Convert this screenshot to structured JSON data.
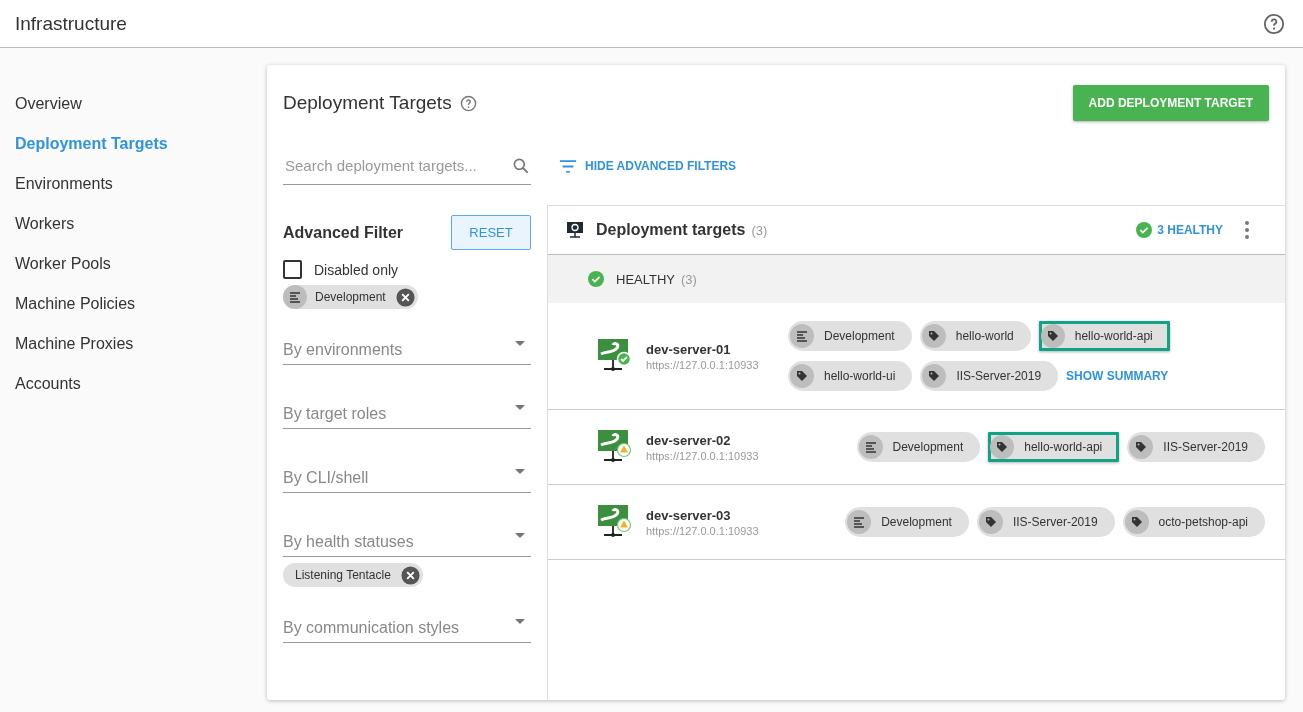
{
  "header": {
    "title": "Infrastructure"
  },
  "sidebar": {
    "items": [
      {
        "label": "Overview",
        "selected": false
      },
      {
        "label": "Deployment Targets",
        "selected": true
      },
      {
        "label": "Environments",
        "selected": false
      },
      {
        "label": "Workers",
        "selected": false
      },
      {
        "label": "Worker Pools",
        "selected": false
      },
      {
        "label": "Machine Policies",
        "selected": false
      },
      {
        "label": "Machine Proxies",
        "selected": false
      },
      {
        "label": "Accounts",
        "selected": false
      }
    ]
  },
  "page": {
    "title": "Deployment Targets",
    "add_button": "ADD DEPLOYMENT TARGET"
  },
  "search": {
    "placeholder": "Search deployment targets..."
  },
  "filters_toggle": "HIDE ADVANCED FILTERS",
  "advanced_filter": {
    "title": "Advanced Filter",
    "reset": "RESET",
    "disabled_only": {
      "label": "Disabled only",
      "checked": false
    },
    "fields": [
      {
        "kind": "environment_chip",
        "label": "Development"
      },
      {
        "kind": "select",
        "placeholder": "By environments"
      },
      {
        "kind": "select",
        "placeholder": "By target roles"
      },
      {
        "kind": "select",
        "placeholder": "By CLI/shell"
      },
      {
        "kind": "select",
        "placeholder": "By health statuses"
      },
      {
        "kind": "chip",
        "label": "Listening Tentacle"
      },
      {
        "kind": "select",
        "placeholder": "By communication styles"
      }
    ]
  },
  "targets_panel": {
    "title": "Deployment targets",
    "count": "(3)",
    "summary": "3 HEALTHY",
    "group": {
      "label": "HEALTHY",
      "count": "(3)"
    },
    "rows": [
      {
        "name": "dev-server-01",
        "url": "https://127.0.0.1:10933",
        "healthy": true,
        "show_summary": "SHOW SUMMARY",
        "chips": [
          {
            "kind": "environment",
            "label": "Development",
            "highlighted": false
          },
          {
            "kind": "tag",
            "label": "hello-world",
            "highlighted": false
          },
          {
            "kind": "tag",
            "label": "hello-world-api",
            "highlighted": true
          },
          {
            "kind": "tag",
            "label": "hello-world-ui",
            "highlighted": false
          },
          {
            "kind": "tag",
            "label": "IIS-Server-2019",
            "highlighted": false
          }
        ]
      },
      {
        "name": "dev-server-02",
        "url": "https://127.0.0.1:10933",
        "healthy": false,
        "chips": [
          {
            "kind": "environment",
            "label": "Development",
            "highlighted": false
          },
          {
            "kind": "tag",
            "label": "hello-world-api",
            "highlighted": true
          },
          {
            "kind": "tag",
            "label": "IIS-Server-2019",
            "highlighted": false
          }
        ]
      },
      {
        "name": "dev-server-03",
        "url": "https://127.0.0.1:10933",
        "healthy": false,
        "chips": [
          {
            "kind": "environment",
            "label": "Development",
            "highlighted": false
          },
          {
            "kind": "tag",
            "label": "IIS-Server-2019",
            "highlighted": false
          },
          {
            "kind": "tag",
            "label": "octo-petshop-api",
            "highlighted": false
          }
        ]
      }
    ]
  }
}
